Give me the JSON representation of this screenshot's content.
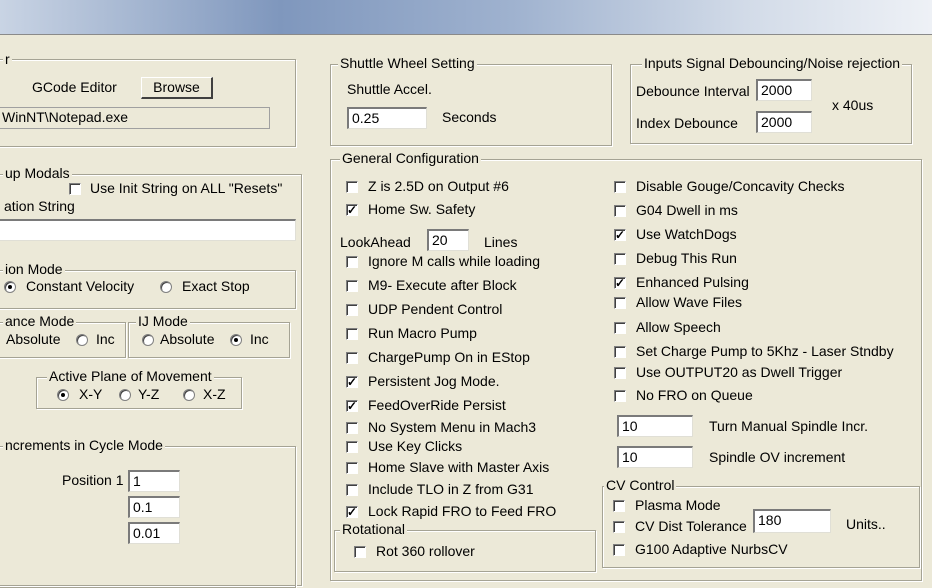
{
  "left": {
    "partial_label_top": "r",
    "gcode_editor_label": "GCode Editor",
    "browse_label": "Browse",
    "editor_path": "WinNT\\Notepad.exe",
    "startup_modals": {
      "legend": "up Modals",
      "use_init_label": "Use Init String on ALL  \"Resets\"",
      "init_string_label": "ation String",
      "init_string_value": ""
    },
    "motion_mode": {
      "legend": "ion Mode",
      "constant_velocity": "Constant Velocity",
      "exact_stop": "Exact Stop"
    },
    "distance_mode": {
      "legend": "ance Mode",
      "absolute": "Absolute",
      "inc": "Inc"
    },
    "ij_mode": {
      "legend": "IJ Mode",
      "absolute": "Absolute",
      "inc": "Inc"
    },
    "active_plane": {
      "legend": "Active Plane of Movement",
      "xy": "X-Y",
      "yz": "Y-Z",
      "xz": "X-Z"
    },
    "increments": {
      "legend": "ncrements in Cycle Mode",
      "position_label": "Position 1",
      "values": [
        "1",
        "0.1",
        "0.01"
      ]
    }
  },
  "shuttle": {
    "legend": "Shuttle Wheel Setting",
    "accel_label": "Shuttle Accel.",
    "accel_value": "0.25",
    "unit": "Seconds"
  },
  "debounce": {
    "legend": "Inputs Signal Debouncing/Noise rejection",
    "interval_label": "Debounce Interval",
    "interval_value": "2000",
    "multiplier": "x 40us",
    "index_label": "Index Debounce",
    "index_value": "2000"
  },
  "general": {
    "legend": "General Configuration",
    "lookahead_label": "LookAhead",
    "lookahead_value": "20",
    "lookahead_unit": "Lines",
    "col1": [
      {
        "label": "Z is 2.5D on Output #6",
        "checked": false
      },
      {
        "label": "Home Sw. Safety",
        "checked": true
      },
      {
        "label": "Ignore M calls while loading",
        "checked": false
      },
      {
        "label": "M9- Execute after Block",
        "checked": false
      },
      {
        "label": "UDP Pendent Control",
        "checked": false
      },
      {
        "label": "Run Macro Pump",
        "checked": false
      },
      {
        "label": "ChargePump On in EStop",
        "checked": false
      },
      {
        "label": "Persistent Jog Mode.",
        "checked": true
      },
      {
        "label": "FeedOverRide Persist",
        "checked": true
      },
      {
        "label": "No System Menu in Mach3",
        "checked": false
      },
      {
        "label": "Use Key Clicks",
        "checked": false
      },
      {
        "label": "Home Slave with Master Axis",
        "checked": false
      },
      {
        "label": "Include TLO in Z from G31",
        "checked": false
      },
      {
        "label": "Lock Rapid FRO to Feed FRO",
        "checked": true
      }
    ],
    "col2": [
      {
        "label": "Disable Gouge/Concavity Checks",
        "checked": false
      },
      {
        "label": "G04 Dwell in ms",
        "checked": false
      },
      {
        "label": "Use WatchDogs",
        "checked": true
      },
      {
        "label": "Debug This Run",
        "checked": false
      },
      {
        "label": "Enhanced Pulsing",
        "checked": true
      },
      {
        "label": "Allow Wave Files",
        "checked": false
      },
      {
        "label": "Allow Speech",
        "checked": false
      },
      {
        "label": "Set Charge Pump to 5Khz  - Laser Stndby",
        "checked": false
      },
      {
        "label": "Use OUTPUT20 as Dwell Trigger",
        "checked": false
      },
      {
        "label": "No FRO on Queue",
        "checked": false
      }
    ],
    "spindle_incr_value": "10",
    "spindle_incr_label": "Turn Manual Spindle Incr.",
    "spindle_ov_value": "10",
    "spindle_ov_label": "Spindle OV increment"
  },
  "rotational": {
    "legend": "Rotational",
    "item": "Rot 360 rollover"
  },
  "cv_control": {
    "legend": "CV Control",
    "plasma_label": "Plasma Mode",
    "cv_dist_label": "CV Dist Tolerance",
    "cv_dist_value": "180",
    "units_label": "Units..",
    "g100_label": "G100 Adaptive NurbsCV"
  }
}
